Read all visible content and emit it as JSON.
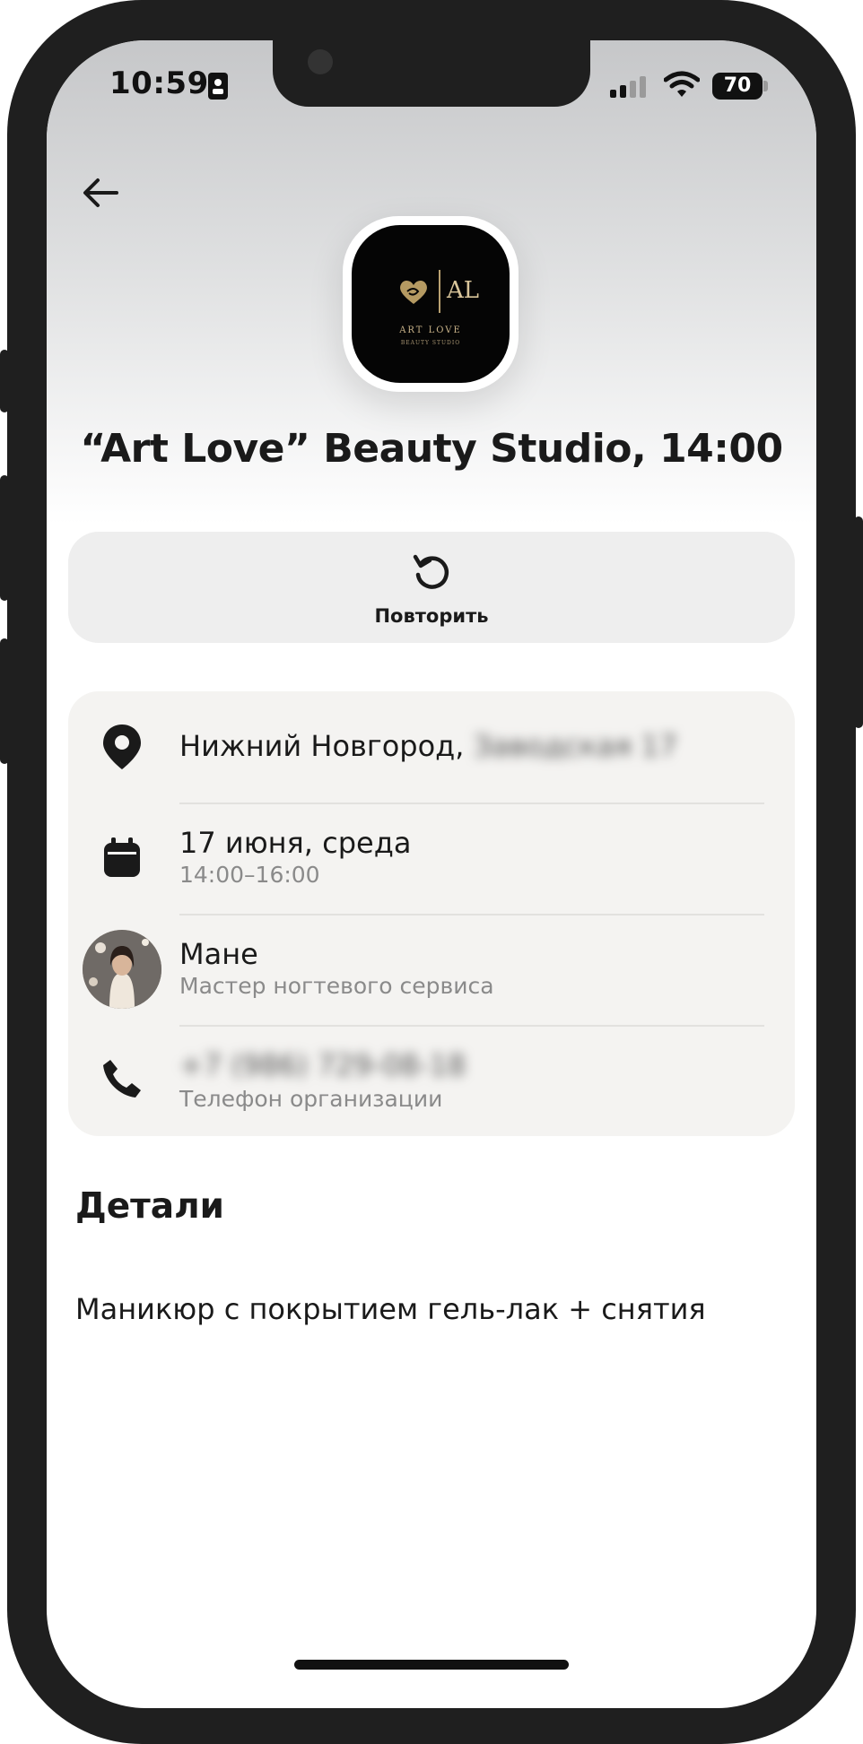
{
  "status_bar": {
    "time": "10:59",
    "battery": "70"
  },
  "header": {
    "logo": {
      "initials": "AL",
      "name": "ART LOVE",
      "subtitle": "BEAUTY STUDIO"
    },
    "title": "“Art Love” Beauty Studio, 14:00"
  },
  "actions": {
    "repeat_label": "Повторить"
  },
  "info": {
    "address_city": "Нижний Новгород,",
    "address_street": "Заводская 17",
    "date": "17 июня, среда",
    "time_range": "14:00–16:00",
    "master_name": "Мане",
    "master_role": "Мастер ногтевого сервиса",
    "phone": "+7 (986) 729-08-18",
    "phone_label": "Телефон организации"
  },
  "details": {
    "title": "Детали",
    "service": "Маникюр с покрытием гель-лак + снятия"
  },
  "icons": {
    "back": "arrow-left-icon",
    "repeat": "refresh-icon",
    "location": "location-pin-icon",
    "calendar": "calendar-icon",
    "phone": "phone-icon"
  },
  "colors": {
    "card_background": "#f4f3f1",
    "button_background": "#eeeeee",
    "text_primary": "#1a1a1a",
    "text_secondary": "#8a8a8a"
  }
}
